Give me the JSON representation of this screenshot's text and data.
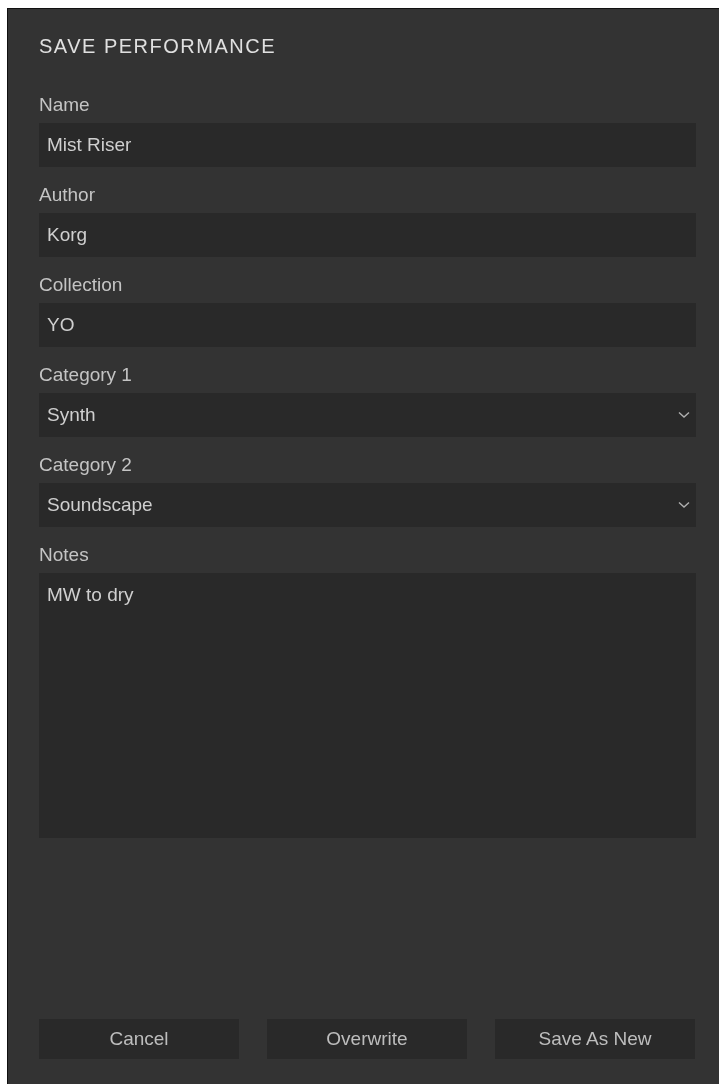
{
  "dialog": {
    "title": "SAVE PERFORMANCE"
  },
  "fields": [
    {
      "label": "Name",
      "kind": "text",
      "value": "Mist Riser"
    },
    {
      "label": "Author",
      "kind": "text",
      "value": "Korg"
    },
    {
      "label": "Collection",
      "kind": "text",
      "value": "YO"
    },
    {
      "label": "Category 1",
      "kind": "select",
      "value": "Synth"
    },
    {
      "label": "Category 2",
      "kind": "select",
      "value": "Soundscape"
    },
    {
      "label": "Notes",
      "kind": "textarea",
      "value": "MW to dry"
    }
  ],
  "buttons": [
    "Cancel",
    "Overwrite",
    "Save As New"
  ]
}
